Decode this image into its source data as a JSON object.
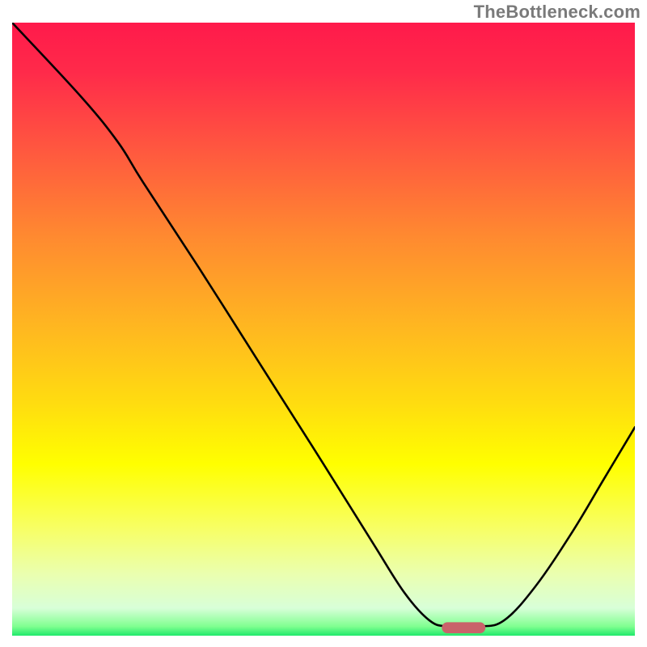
{
  "watermark": "TheBottleneck.com",
  "chart_data": {
    "type": "line",
    "title": "",
    "xlabel": "",
    "ylabel": "",
    "xlim": [
      0,
      100
    ],
    "ylim": [
      0,
      100
    ],
    "grid": false,
    "legend": false,
    "background_gradient": {
      "stops": [
        {
          "offset": 0.0,
          "color": "#ff1a4b"
        },
        {
          "offset": 0.08,
          "color": "#ff2a4a"
        },
        {
          "offset": 0.2,
          "color": "#ff5540"
        },
        {
          "offset": 0.35,
          "color": "#ff8a30"
        },
        {
          "offset": 0.5,
          "color": "#ffb820"
        },
        {
          "offset": 0.62,
          "color": "#ffdc10"
        },
        {
          "offset": 0.72,
          "color": "#ffff00"
        },
        {
          "offset": 0.82,
          "color": "#f8ff60"
        },
        {
          "offset": 0.9,
          "color": "#eaffb0"
        },
        {
          "offset": 0.955,
          "color": "#d8ffd8"
        },
        {
          "offset": 0.985,
          "color": "#80ff90"
        },
        {
          "offset": 1.0,
          "color": "#20e96b"
        }
      ]
    },
    "series": [
      {
        "name": "bottleneck-curve",
        "stroke": "#000000",
        "stroke_width": 2.6,
        "points": [
          {
            "x": 0.0,
            "y": 100.0
          },
          {
            "x": 11.0,
            "y": 88.0
          },
          {
            "x": 17.0,
            "y": 80.5
          },
          {
            "x": 21.0,
            "y": 74.0
          },
          {
            "x": 30.0,
            "y": 60.0
          },
          {
            "x": 40.0,
            "y": 44.0
          },
          {
            "x": 50.0,
            "y": 28.0
          },
          {
            "x": 58.0,
            "y": 15.0
          },
          {
            "x": 63.0,
            "y": 7.0
          },
          {
            "x": 67.0,
            "y": 2.5
          },
          {
            "x": 70.0,
            "y": 1.5
          },
          {
            "x": 75.0,
            "y": 1.5
          },
          {
            "x": 79.0,
            "y": 2.5
          },
          {
            "x": 84.0,
            "y": 8.0
          },
          {
            "x": 90.0,
            "y": 17.0
          },
          {
            "x": 95.0,
            "y": 25.5
          },
          {
            "x": 100.0,
            "y": 34.0
          }
        ]
      }
    ],
    "marker": {
      "name": "optimal-range",
      "shape": "rounded-bar",
      "x_center": 72.5,
      "y": 1.3,
      "width": 7.0,
      "height": 1.8,
      "fill": "#c9636a"
    }
  }
}
